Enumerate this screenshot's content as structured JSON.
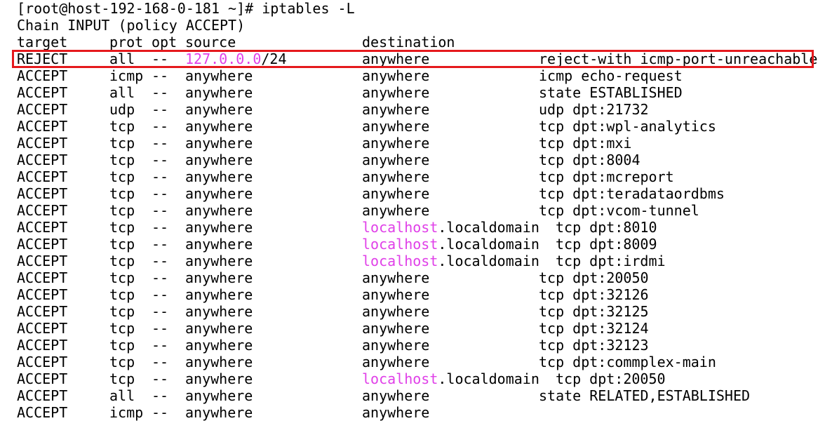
{
  "prompt_line": "[root@host-192-168-0-181 ~]# iptables -L",
  "chain_header": "Chain INPUT (policy ACCEPT)",
  "columns": {
    "target": "target",
    "prot": "prot",
    "opt": "opt",
    "source": "source",
    "destination": "destination"
  },
  "colors": {
    "background": "#ffffff",
    "text": "#000000",
    "highlight": "#e040e8",
    "box": "#e5191d"
  },
  "rows": [
    {
      "target": "REJECT",
      "prot": "all",
      "opt": "--",
      "source_hl": "127.0.0.0",
      "source_rest": "/24",
      "dest_hl": "",
      "dest_rest": "anywhere",
      "extra": "reject-with icmp-port-unreachable",
      "highlighted": true
    },
    {
      "target": "ACCEPT",
      "prot": "icmp",
      "opt": "--",
      "source_hl": "",
      "source_rest": "anywhere",
      "dest_hl": "",
      "dest_rest": "anywhere",
      "extra": "icmp echo-request"
    },
    {
      "target": "ACCEPT",
      "prot": "all",
      "opt": "--",
      "source_hl": "",
      "source_rest": "anywhere",
      "dest_hl": "",
      "dest_rest": "anywhere",
      "extra": "state ESTABLISHED"
    },
    {
      "target": "ACCEPT",
      "prot": "udp",
      "opt": "--",
      "source_hl": "",
      "source_rest": "anywhere",
      "dest_hl": "",
      "dest_rest": "anywhere",
      "extra": "udp dpt:21732"
    },
    {
      "target": "ACCEPT",
      "prot": "tcp",
      "opt": "--",
      "source_hl": "",
      "source_rest": "anywhere",
      "dest_hl": "",
      "dest_rest": "anywhere",
      "extra": "tcp dpt:wpl-analytics"
    },
    {
      "target": "ACCEPT",
      "prot": "tcp",
      "opt": "--",
      "source_hl": "",
      "source_rest": "anywhere",
      "dest_hl": "",
      "dest_rest": "anywhere",
      "extra": "tcp dpt:mxi"
    },
    {
      "target": "ACCEPT",
      "prot": "tcp",
      "opt": "--",
      "source_hl": "",
      "source_rest": "anywhere",
      "dest_hl": "",
      "dest_rest": "anywhere",
      "extra": "tcp dpt:8004"
    },
    {
      "target": "ACCEPT",
      "prot": "tcp",
      "opt": "--",
      "source_hl": "",
      "source_rest": "anywhere",
      "dest_hl": "",
      "dest_rest": "anywhere",
      "extra": "tcp dpt:mcreport"
    },
    {
      "target": "ACCEPT",
      "prot": "tcp",
      "opt": "--",
      "source_hl": "",
      "source_rest": "anywhere",
      "dest_hl": "",
      "dest_rest": "anywhere",
      "extra": "tcp dpt:teradataordbms"
    },
    {
      "target": "ACCEPT",
      "prot": "tcp",
      "opt": "--",
      "source_hl": "",
      "source_rest": "anywhere",
      "dest_hl": "",
      "dest_rest": "anywhere",
      "extra": "tcp dpt:vcom-tunnel"
    },
    {
      "target": "ACCEPT",
      "prot": "tcp",
      "opt": "--",
      "source_hl": "",
      "source_rest": "anywhere",
      "dest_hl": "localhost",
      "dest_rest": ".localdomain",
      "extra": "tcp dpt:8010",
      "shift": true
    },
    {
      "target": "ACCEPT",
      "prot": "tcp",
      "opt": "--",
      "source_hl": "",
      "source_rest": "anywhere",
      "dest_hl": "localhost",
      "dest_rest": ".localdomain",
      "extra": "tcp dpt:8009",
      "shift": true
    },
    {
      "target": "ACCEPT",
      "prot": "tcp",
      "opt": "--",
      "source_hl": "",
      "source_rest": "anywhere",
      "dest_hl": "localhost",
      "dest_rest": ".localdomain",
      "extra": "tcp dpt:irdmi",
      "shift": true
    },
    {
      "target": "ACCEPT",
      "prot": "tcp",
      "opt": "--",
      "source_hl": "",
      "source_rest": "anywhere",
      "dest_hl": "",
      "dest_rest": "anywhere",
      "extra": "tcp dpt:20050"
    },
    {
      "target": "ACCEPT",
      "prot": "tcp",
      "opt": "--",
      "source_hl": "",
      "source_rest": "anywhere",
      "dest_hl": "",
      "dest_rest": "anywhere",
      "extra": "tcp dpt:32126"
    },
    {
      "target": "ACCEPT",
      "prot": "tcp",
      "opt": "--",
      "source_hl": "",
      "source_rest": "anywhere",
      "dest_hl": "",
      "dest_rest": "anywhere",
      "extra": "tcp dpt:32125"
    },
    {
      "target": "ACCEPT",
      "prot": "tcp",
      "opt": "--",
      "source_hl": "",
      "source_rest": "anywhere",
      "dest_hl": "",
      "dest_rest": "anywhere",
      "extra": "tcp dpt:32124"
    },
    {
      "target": "ACCEPT",
      "prot": "tcp",
      "opt": "--",
      "source_hl": "",
      "source_rest": "anywhere",
      "dest_hl": "",
      "dest_rest": "anywhere",
      "extra": "tcp dpt:32123"
    },
    {
      "target": "ACCEPT",
      "prot": "tcp",
      "opt": "--",
      "source_hl": "",
      "source_rest": "anywhere",
      "dest_hl": "",
      "dest_rest": "anywhere",
      "extra": "tcp dpt:commplex-main"
    },
    {
      "target": "ACCEPT",
      "prot": "tcp",
      "opt": "--",
      "source_hl": "",
      "source_rest": "anywhere",
      "dest_hl": "localhost",
      "dest_rest": ".localdomain",
      "extra": "tcp dpt:20050",
      "shift": true
    },
    {
      "target": "ACCEPT",
      "prot": "all",
      "opt": "--",
      "source_hl": "",
      "source_rest": "anywhere",
      "dest_hl": "",
      "dest_rest": "anywhere",
      "extra": "state RELATED,ESTABLISHED"
    },
    {
      "target": "ACCEPT",
      "prot": "icmp",
      "opt": "--",
      "source_hl": "",
      "source_rest": "anywhere",
      "dest_hl": "",
      "dest_rest": "anywhere",
      "extra": ""
    }
  ]
}
